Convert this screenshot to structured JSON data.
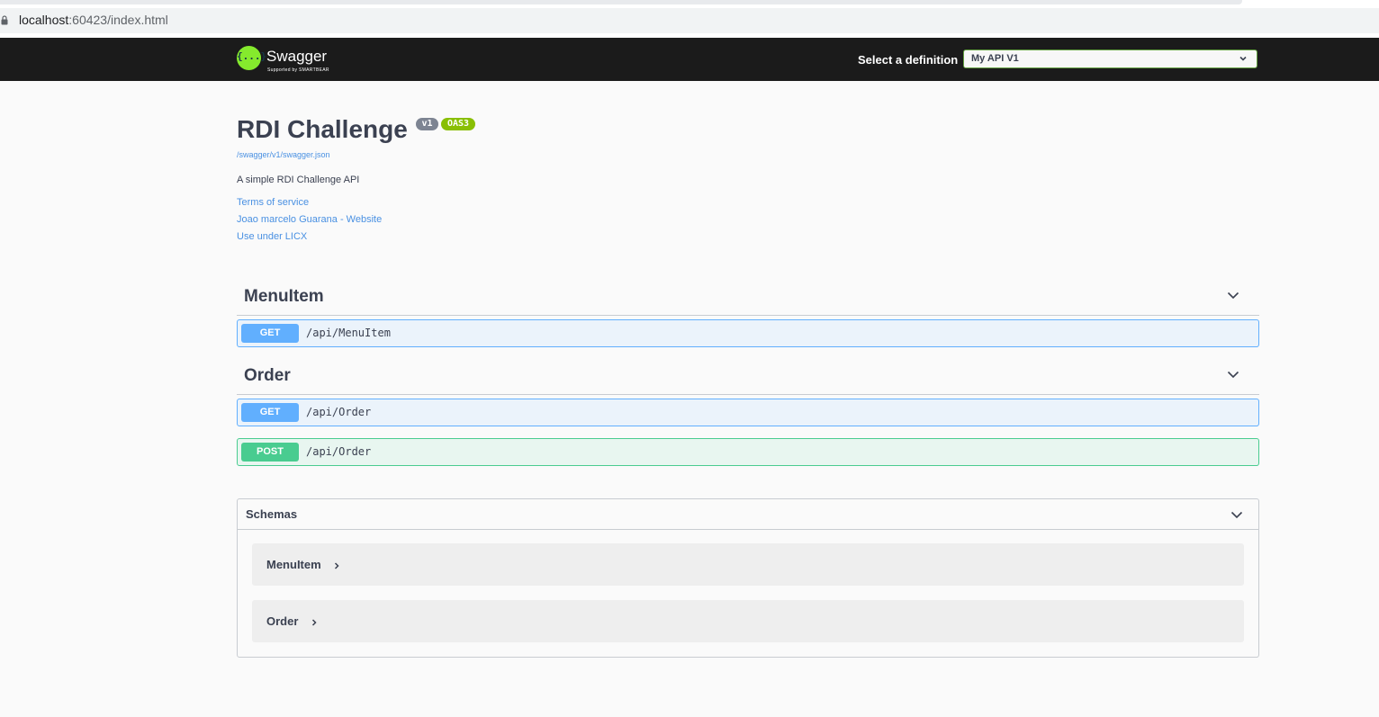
{
  "browser": {
    "url_host": "localhost",
    "url_rest": ":60423/index.html"
  },
  "topbar": {
    "logo_glyph": "{...}",
    "logo_text": "Swagger",
    "logo_sub": "Supported by SMARTBEAR",
    "select_label": "Select a definition",
    "selected_definition": "My API V1",
    "colors": {
      "background": "#1b1b1b",
      "logo": "#85ea2d",
      "select_border": "#62a03f"
    }
  },
  "info": {
    "title": "RDI Challenge",
    "version_badge": "v1",
    "oas_badge": "OAS3",
    "spec_url": "/swagger/v1/swagger.json",
    "description": "A simple RDI Challenge API",
    "links": [
      "Terms of service",
      "Joao marcelo Guarana - Website",
      "Use under LICX"
    ]
  },
  "tags": [
    {
      "name": "MenuItem",
      "operations": [
        {
          "method": "GET",
          "path": "/api/MenuItem"
        }
      ]
    },
    {
      "name": "Order",
      "operations": [
        {
          "method": "GET",
          "path": "/api/Order"
        },
        {
          "method": "POST",
          "path": "/api/Order"
        }
      ]
    }
  ],
  "schemas": {
    "title": "Schemas",
    "models": [
      "MenuItem",
      "Order"
    ]
  },
  "colors": {
    "get": "#61affe",
    "post": "#49cc90",
    "link": "#4990e2",
    "text": "#3b4151"
  },
  "icons": [
    "lock-icon",
    "swagger-logo-icon",
    "chevron-down-icon",
    "chevron-right-icon"
  ]
}
